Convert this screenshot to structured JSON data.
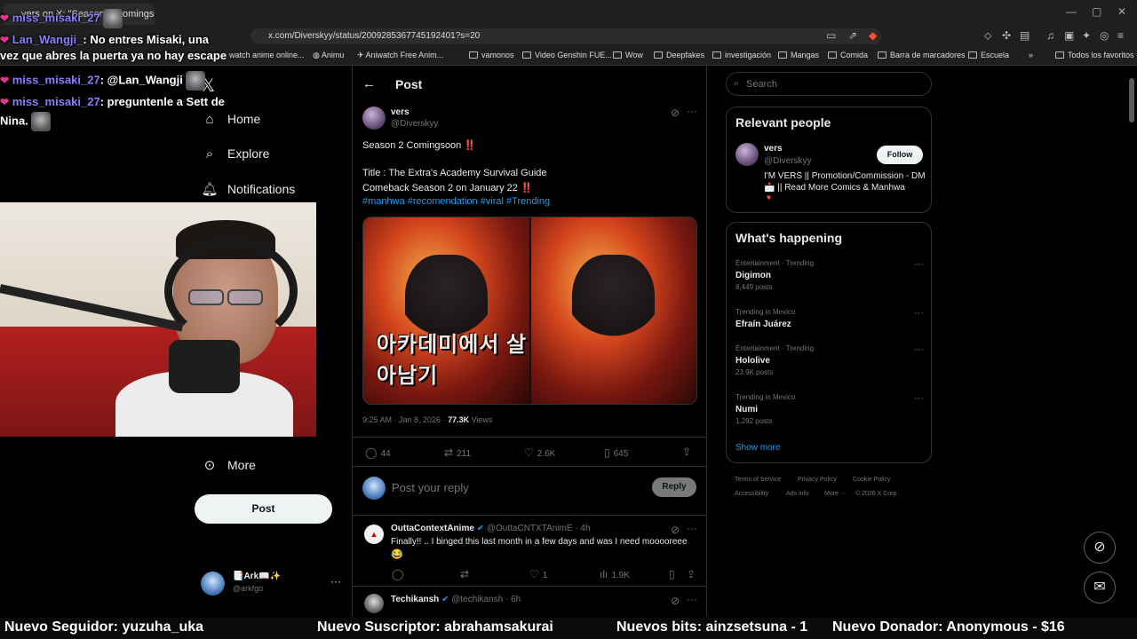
{
  "browser": {
    "tab_title": "vers on X: \"Season 2 Comingsoo",
    "url": "x.com/Diverskyy/status/2009285367745192401?s=20",
    "bookmarks": [
      "watch anime online...",
      "Animu",
      "Aniwatch Free Anim...",
      "vamonos",
      "Video Genshin FUE...",
      "Wow",
      "Deepfakes",
      "investigación",
      "Mangas",
      "Comida",
      "Barra de marcadores",
      "Escuela"
    ],
    "all_bookmarks": "Todos los favoritos"
  },
  "nav": {
    "home": "Home",
    "explore": "Explore",
    "notifications": "Notifications",
    "more": "More",
    "post_button": "Post",
    "account_name": "📑Ark📖✨",
    "account_handle": "@arkfgo"
  },
  "post_header": {
    "title": "Post"
  },
  "tweet": {
    "author_name": "vers",
    "author_handle": "@Diverskyy",
    "line1": "Season 2 Comingsoon",
    "line2": "Title : The Extra's Academy Survival Guide",
    "line3": "Comeback Season 2 on January 22",
    "hashtags": "#manhwa #recomendation #viral #Trending",
    "image_text": "아카데미에서 살아남기",
    "time": "9:25 AM · Jan 8, 2026 · ",
    "views_count": "77.3K",
    "views_label": " Views",
    "replies": "44",
    "reposts": "211",
    "likes": "2.6K",
    "bookmarks": "645",
    "exclaim": "‼️"
  },
  "reply_box": {
    "placeholder": "Post your reply",
    "button": "Reply"
  },
  "replies": [
    {
      "name": "OuttaContextAnime",
      "handle": "@OuttaCNTXTAnimE · 4h",
      "text": "Finally!! .. I binged this last month in a few days and was I need mooooreee",
      "emoji": "😂",
      "likes": "1",
      "views": "1.9K"
    },
    {
      "name": "Techikansh",
      "handle": "@techikansh · 6h"
    }
  ],
  "sidebar": {
    "search_placeholder": "Search",
    "relevant_title": "Relevant people",
    "person_name": "vers",
    "person_handle": "@Diverskyy",
    "person_bio": "I'M VERS || Promotion/Commission - DM📩 || Read More Comics & Manhwa",
    "person_bio_end": "🔻",
    "follow_button": "Follow",
    "happening_title": "What's happening",
    "trends": [
      {
        "category": "Entertainment · Trending",
        "name": "Digimon",
        "count": "8,449 posts"
      },
      {
        "category": "Trending in Mexico",
        "name": "Efraín Juárez",
        "count": ""
      },
      {
        "category": "Entertainment · Trending",
        "name": "Hololive",
        "count": "23.9K posts"
      },
      {
        "category": "Trending in Mexico",
        "name": "Numi",
        "count": "1,292 posts"
      }
    ],
    "show_more": "Show more",
    "footer": [
      "Terms of Service",
      "Privacy Policy",
      "Cookie Policy",
      "Accessibility",
      "Ads info",
      "More ···",
      "© 2026 X Corp."
    ]
  },
  "overlay": {
    "chat": [
      {
        "user": "miss_misaki_27",
        "text": ""
      },
      {
        "user": "Lan_Wangji_",
        "text": "No entres Misaki, una"
      },
      {
        "user": "",
        "text": "vez que abres la puerta ya no hay escape"
      },
      {
        "user": "miss_misaki_27",
        "text": "@Lan_Wangji"
      },
      {
        "user": "miss_misaki_27",
        "text": "preguntenle a Sett de"
      },
      {
        "user": "",
        "text": "Nina."
      }
    ],
    "alerts": [
      "Nuevo Seguidor: yuzuha_uka",
      "Nuevo Suscriptor: abrahamsakurai",
      "Nuevos bits: ainzsetsuna - 1",
      "Nuevo Donador: Anonymous - $16"
    ]
  }
}
